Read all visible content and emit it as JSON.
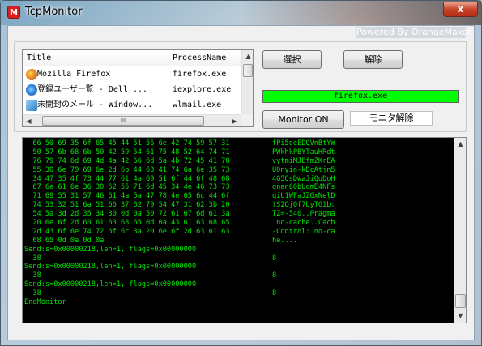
{
  "window": {
    "title": "TcpMonitor",
    "app_icon_letter": "M",
    "close_symbol": "x",
    "powered_by": "Powered By OrangeMaker"
  },
  "process_list": {
    "columns": [
      "Title",
      "ProcessName"
    ],
    "rows": [
      {
        "title": "Mozilla Firefox",
        "process": "firefox.exe",
        "icon": "firefox-icon"
      },
      {
        "title": "登録ユーザー覧 - Dell ...",
        "process": "iexplore.exe",
        "icon": "ie-icon"
      },
      {
        "title": "未開封のメール - Window...",
        "process": "wlmail.exe",
        "icon": "mail-icon"
      }
    ],
    "hscroll_grip": "III"
  },
  "buttons": {
    "select": "選択",
    "release": "解除",
    "monitor_on": "Monitor ON"
  },
  "selected_process": "firefox.exe",
  "monitor_state": "モニタ解除",
  "console": {
    "lines": [
      {
        "hex": "  66 50 69 35 6f 65 45 44 51 56 6e 42 74 59 57 31",
        "asc": "fPi5oeEDQVnBtYW"
      },
      {
        "hex": "  50 57 6b 68 6b 50 42 59 54 61 75 48 52 64 74 71",
        "asc": "PWkhkPBYTauHRdt"
      },
      {
        "hex": "  76 79 74 6d 69 4d 4a 42 66 6d 5a 4b 72 45 41 78",
        "asc": "vytmiMJBfmZKrEA"
      },
      {
        "hex": "  55 30 6e 79 69 6e 2d 6b 44 63 41 74 6a 6e 35 73",
        "asc": "U0nyin-kDcAtjn5"
      },
      {
        "hex": "  34 47 35 4f 73 44 77 61 4a 69 51 6f 44 6f 48 68",
        "asc": "4G5OsDwaJiQoDoH"
      },
      {
        "hex": "  67 6e 61 6e 36 30 62 55 71 6d 45 34 4e 46 73 73",
        "asc": "gnan60bUqmE4NFs"
      },
      {
        "hex": "  71 69 55 31 57 46 61 4a 5a 47 78 4e 65 6c 44 6f",
        "asc": "qiU1WFaJZGxNelD"
      },
      {
        "hex": "  74 53 32 51 6a 51 66 37 62 79 54 47 31 62 3b 20",
        "asc": "tS2QjQf7byTG1b;"
      },
      {
        "hex": "  54 5a 3d 2d 35 34 30 0d 0a 50 72 61 67 6d 61 3a",
        "asc": "TZ=-540..Pragma"
      },
      {
        "hex": "  20 6e 6f 2d 63 61 63 68 65 0d 0a 43 61 63 68 65",
        "asc": " no-cache..Cach"
      },
      {
        "hex": "  2d 43 6f 6e 74 72 6f 6c 3a 20 6e 6f 2d 63 61 63",
        "asc": "-Control: no-ca"
      },
      {
        "hex": "  68 65 0d 0a 0d 0a",
        "asc": "he...."
      },
      {
        "hex": "Send:s=0x00000218,len=1, flags=0x00000000",
        "asc": ""
      },
      {
        "hex": "  38",
        "asc": "8"
      },
      {
        "hex": "Send:s=0x00000218,len=1, flags=0x00000000",
        "asc": ""
      },
      {
        "hex": "  38",
        "asc": "8"
      },
      {
        "hex": "Send:s=0x00000218,len=1, flags=0x00000000",
        "asc": ""
      },
      {
        "hex": "  38",
        "asc": "8"
      },
      {
        "hex": "EndMonitor",
        "asc": ""
      }
    ]
  },
  "colors": {
    "console_text": "#00e600",
    "selected_bar": "#00ff00",
    "close_button": "#c7442a"
  }
}
